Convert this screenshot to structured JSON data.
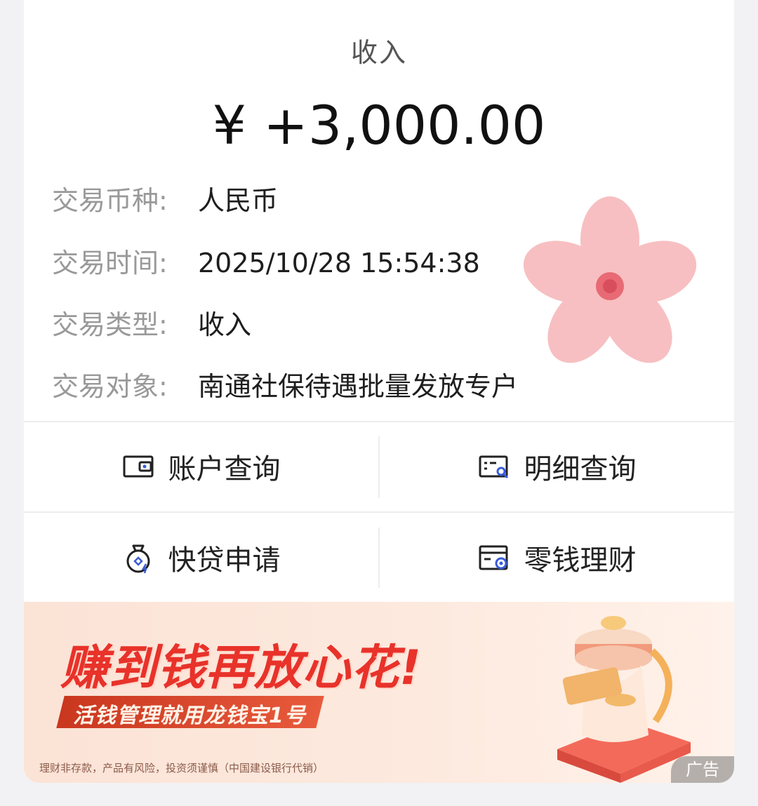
{
  "header": {
    "title": "收入"
  },
  "amount": "¥ +3,000.00",
  "details": [
    {
      "label": "交易币种:",
      "value": "人民币"
    },
    {
      "label": "交易时间:",
      "value": "2025/10/28 15:54:38"
    },
    {
      "label": "交易类型:",
      "value": "收入"
    },
    {
      "label": "交易对象:",
      "value": "南通社保待遇批量发放专户"
    }
  ],
  "actions": {
    "account_query": {
      "label": "账户查询",
      "icon": "wallet-icon"
    },
    "detail_query": {
      "label": "明细查询",
      "icon": "statement-search-icon"
    },
    "quick_loan": {
      "label": "快贷申请",
      "icon": "money-bag-icon"
    },
    "wealth": {
      "label": "零钱理财",
      "icon": "card-coin-icon"
    }
  },
  "banner": {
    "slogan": "赚到钱再放心花!",
    "sub": "活钱管理就用龙钱宝1号",
    "disclaimer": "理财非存款，产品有风险，投资须谨慎（中国建设银行代销）",
    "ad_tag": "广告"
  },
  "colors": {
    "accent_red": "#e8322a",
    "icon_blue": "#3a5bd9",
    "label_gray": "#999999"
  }
}
